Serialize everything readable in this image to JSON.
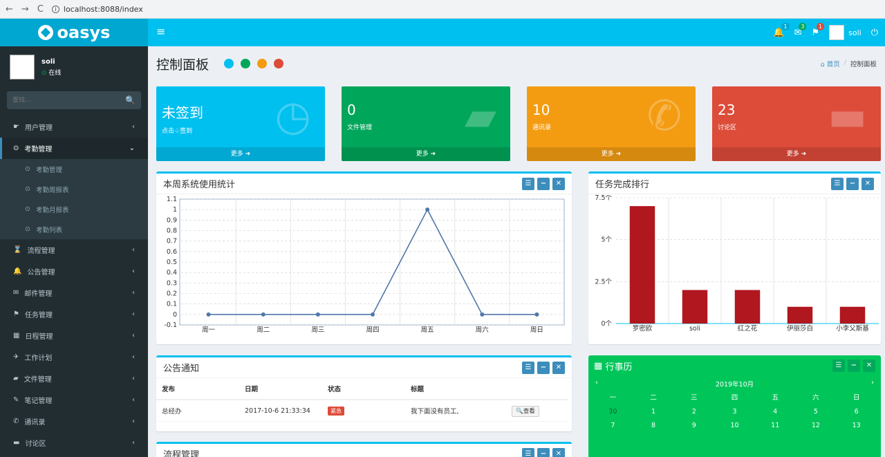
{
  "browser": {
    "url": "localhost:8088/index",
    "back": "←",
    "fwd": "→",
    "reload": "C",
    "info": "i"
  },
  "top": {
    "logo": "oasys",
    "menu": "≡",
    "bell": "🔔",
    "bell_count": "1",
    "mail": "✉",
    "mail_count": "3",
    "flag": "⚑",
    "flag_count": "1",
    "username": "soli",
    "power": "⏻"
  },
  "colors": {
    "aqua": "#00c0ef",
    "green": "#00a65a",
    "orange": "#f39c12",
    "red": "#dd4b39",
    "sidebar": "#222d32",
    "bar": "#b0171f",
    "line": "#5177a8",
    "calendar": "#00c65a"
  },
  "sidebar": {
    "name": "soli",
    "status": "在线",
    "search_placeholder": "查找...",
    "search_icon": "🔍",
    "items": [
      {
        "icon": "☛",
        "label": "用户管理",
        "arrow": "‹"
      },
      {
        "icon": "⊙",
        "label": "考勤管理",
        "arrow": "⌄"
      },
      {
        "icon": "⌛",
        "label": "流程管理",
        "arrow": "‹"
      },
      {
        "icon": "🔔",
        "label": "公告管理",
        "arrow": "‹"
      },
      {
        "icon": "✉",
        "label": "邮件管理",
        "arrow": "‹"
      },
      {
        "icon": "⚑",
        "label": "任务管理",
        "arrow": "‹"
      },
      {
        "icon": "▦",
        "label": "日程管理",
        "arrow": "‹"
      },
      {
        "icon": "✈",
        "label": "工作计划",
        "arrow": "‹"
      },
      {
        "icon": "▰",
        "label": "文件管理",
        "arrow": "‹"
      },
      {
        "icon": "✎",
        "label": "笔记管理",
        "arrow": "‹"
      },
      {
        "icon": "✆",
        "label": "通讯录",
        "arrow": "‹"
      },
      {
        "icon": "▬",
        "label": "讨论区",
        "arrow": "‹"
      }
    ],
    "sub": [
      {
        "label": "考勤管理"
      },
      {
        "label": "考勤周报表"
      },
      {
        "label": "考勤月报表"
      },
      {
        "label": "考勤列表"
      }
    ],
    "sub_icon": "⊙"
  },
  "header": {
    "title": "控制面板",
    "breadcrumb_home": "首页",
    "breadcrumb_sep": "/",
    "breadcrumb_current": "控制面板"
  },
  "tiles": [
    {
      "value": "未签到",
      "label": "点击♤签到",
      "more": "更多 ➜",
      "icon": "◷"
    },
    {
      "value": "0",
      "label": "文件管理",
      "more": "更多 ➜",
      "icon": "▰"
    },
    {
      "value": "10",
      "label": "通讯录",
      "more": "更多 ➜",
      "icon": "✆"
    },
    {
      "value": "23",
      "label": "讨论区",
      "more": "更多 ➜",
      "icon": "▬"
    }
  ],
  "tools": {
    "menu": "☰",
    "min": "−",
    "close": "✕"
  },
  "line_box": {
    "title": "本周系统使用统计"
  },
  "bar_box": {
    "title": "任务完成排行"
  },
  "notice_box": {
    "title": "公告通知",
    "headers": [
      "发布",
      "日期",
      "状态",
      "标题"
    ],
    "rows": [
      {
        "pub": "总经办",
        "date": "2017-10-6 21:33:34",
        "status": "紧急",
        "title": "我下面没有员工,",
        "btn": "🔍查看"
      }
    ]
  },
  "flow_box": {
    "title": "流程管理"
  },
  "calendar": {
    "icon": "▦",
    "title": "行事历",
    "month": "2019年10月",
    "prev": "‹",
    "next": "›",
    "weekdays": [
      "一",
      "二",
      "三",
      "四",
      "五",
      "六",
      "日"
    ],
    "days": [
      [
        "30",
        "1",
        "2",
        "3",
        "4",
        "5",
        "6"
      ],
      [
        "7",
        "8",
        "9",
        "10",
        "11",
        "12",
        "13"
      ]
    ]
  },
  "chart_data": [
    {
      "type": "line",
      "categories": [
        "周一",
        "周二",
        "周三",
        "周四",
        "周五",
        "周六",
        "周日"
      ],
      "series": [
        {
          "values": [
            0,
            0,
            0,
            0,
            1,
            0,
            0
          ]
        }
      ],
      "ylim": [
        -0.1,
        1.1
      ],
      "yticks": [
        "1.1",
        "1",
        "0.9",
        "0.8",
        "0.7",
        "0.6",
        "0.5",
        "0.4",
        "0.3",
        "0.2",
        "0.1",
        "0",
        "-0.1"
      ],
      "grid": true
    },
    {
      "type": "bar",
      "categories": [
        "罗密欧",
        "soli",
        "红之花",
        "伊丽莎白",
        "小李父斯基"
      ],
      "values": [
        7,
        2,
        2,
        1,
        1
      ],
      "ylim": [
        0,
        7.5
      ],
      "yticks": [
        "7.5个",
        "5个",
        "2.5个",
        "0个"
      ],
      "grid": true
    }
  ]
}
